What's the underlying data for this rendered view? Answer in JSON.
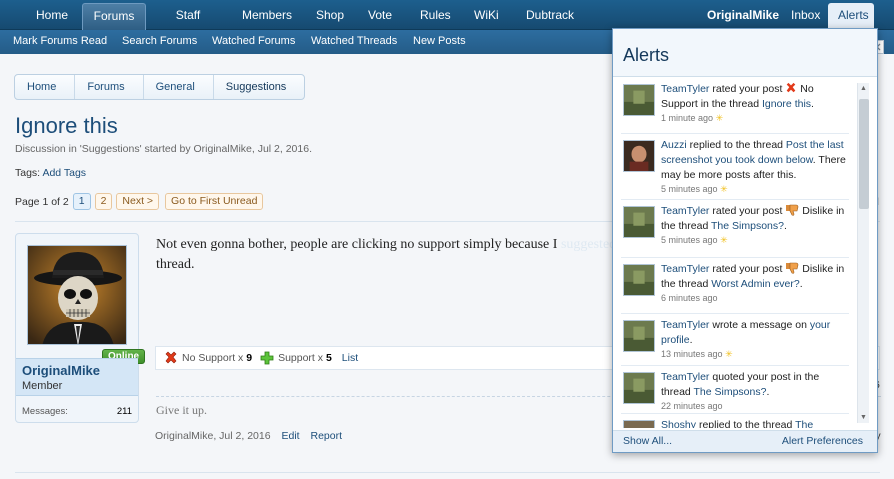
{
  "nav": {
    "tabs": [
      "Home",
      "Forums",
      "Staff Team",
      "Members",
      "Shop",
      "Vote",
      "Rules",
      "WiKi",
      "Dubtrack"
    ],
    "user": "OriginalMike",
    "inbox": "Inbox",
    "alerts": "Alerts"
  },
  "subnav": [
    "Mark Forums Read",
    "Search Forums",
    "Watched Forums",
    "Watched Threads",
    "New Posts"
  ],
  "breadcrumb": [
    "Home",
    "Forums",
    "General",
    "Suggestions"
  ],
  "thread": {
    "title": "Ignore this",
    "meta": "Discussion in 'Suggestions' started by OriginalMike, Jul 2, 2016.",
    "tags_label": "Tags:",
    "tags_link": "Add Tags"
  },
  "pagination": {
    "label": "Page 1 of 2",
    "pages": [
      "1",
      "2"
    ],
    "next": "Next >",
    "first_unread": "Go to First Unread"
  },
  "post": {
    "username": "OriginalMike",
    "user_title": "Member",
    "online": "Online",
    "messages_label": "Messages:",
    "messages_value": "211",
    "text_line1": "Not even gonna bother, people are clicking no support simply because I",
    "text_line2": "thread.",
    "text_hidden": "suggested this after creating the",
    "ratings": {
      "no_support": "No Support x",
      "no_support_count": "9",
      "support": "Support x",
      "support_count": "5",
      "list": "List"
    },
    "signature": "Give it up.",
    "footer_author": "OriginalMike, Jul 2, 2016",
    "edit": "Edit",
    "report": "Report"
  },
  "right_clips": [
    "d",
    "6",
    "ly"
  ],
  "alerts_popup": {
    "title": "Alerts",
    "items": [
      {
        "who": "TeamTyler",
        "pre": " rated your post ",
        "rating": "No Support",
        "mid": " in the thread ",
        "link": "Ignore this",
        "post": ".",
        "time": "1 minute ago"
      },
      {
        "who": "Auzzi",
        "pre": " replied to the thread ",
        "link": "Post the last screenshot you took down below",
        "post": ". There may be more posts after this.",
        "time": "5 minutes ago"
      },
      {
        "who": "TeamTyler",
        "pre": " rated your post ",
        "rating": "Dislike",
        "mid": " in the thread ",
        "link": "The Simpsons?",
        "post": ".",
        "time": "5 minutes ago"
      },
      {
        "who": "TeamTyler",
        "pre": " rated your post ",
        "rating": "Dislike",
        "mid": " in the thread ",
        "link": "Worst Admin ever?",
        "post": ".",
        "time": "6 minutes ago"
      },
      {
        "who": "TeamTyler",
        "pre": " wrote a message on ",
        "link": "your profile",
        "post": ".",
        "time": "13 minutes ago"
      },
      {
        "who": "TeamTyler",
        "pre": " quoted your post in the thread ",
        "link": "The Simpsons?",
        "post": ".",
        "time": "22 minutes ago"
      },
      {
        "who": "Shoshy",
        "pre": " replied to the thread ",
        "link": "The",
        "post": "",
        "time": ""
      }
    ],
    "show_all": "Show All...",
    "preferences": "Alert Preferences"
  }
}
